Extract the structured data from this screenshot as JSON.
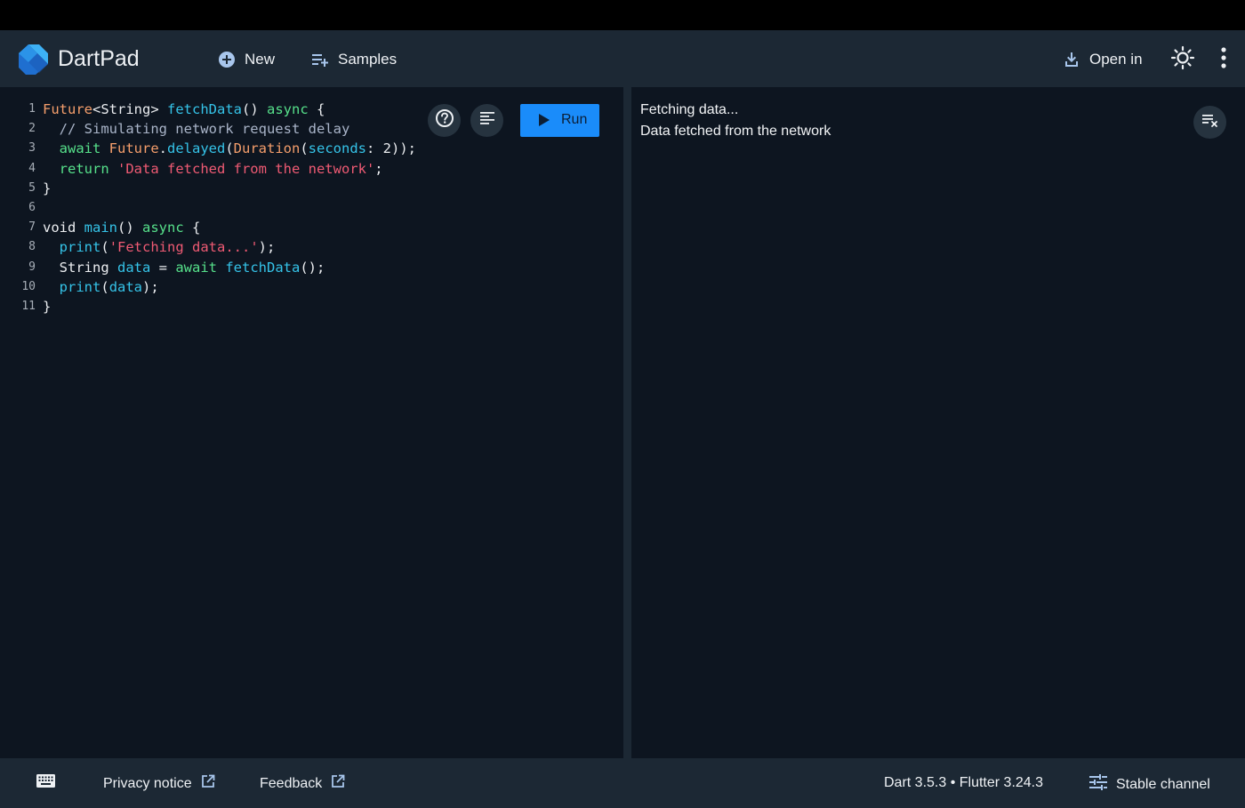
{
  "app": {
    "title": "DartPad"
  },
  "header": {
    "new_label": "New",
    "samples_label": "Samples",
    "open_in_label": "Open in"
  },
  "editor": {
    "run_label": "Run",
    "line_numbers": [
      "1",
      "2",
      "3",
      "4",
      "5",
      "6",
      "7",
      "8",
      "9",
      "10",
      "11"
    ],
    "code_lines": [
      [
        [
          "Future",
          "type"
        ],
        [
          "<String> ",
          "plain"
        ],
        [
          "fetchData",
          "func"
        ],
        [
          "() ",
          "plain"
        ],
        [
          "async",
          "kw"
        ],
        [
          " {",
          "plain"
        ]
      ],
      [
        [
          "  // Simulating network request delay",
          "cmt"
        ]
      ],
      [
        [
          "  await ",
          "kw"
        ],
        [
          "Future",
          "type"
        ],
        [
          ".",
          "plain"
        ],
        [
          "delayed",
          "func"
        ],
        [
          "(",
          "plain"
        ],
        [
          "Duration",
          "type"
        ],
        [
          "(",
          "plain"
        ],
        [
          "seconds",
          "func"
        ],
        [
          ": 2));",
          "plain"
        ]
      ],
      [
        [
          "  return ",
          "kw"
        ],
        [
          "'Data fetched from the network'",
          "str"
        ],
        [
          ";",
          "plain"
        ]
      ],
      [
        [
          "}",
          "plain"
        ]
      ],
      [
        [
          "",
          "plain"
        ]
      ],
      [
        [
          "void ",
          "plain"
        ],
        [
          "main",
          "func"
        ],
        [
          "() ",
          "plain"
        ],
        [
          "async",
          "kw"
        ],
        [
          " {",
          "plain"
        ]
      ],
      [
        [
          "  ",
          "plain"
        ],
        [
          "print",
          "func"
        ],
        [
          "(",
          "plain"
        ],
        [
          "'Fetching data...'",
          "str"
        ],
        [
          ");",
          "plain"
        ]
      ],
      [
        [
          "  String ",
          "plain"
        ],
        [
          "data",
          "func"
        ],
        [
          " = ",
          "plain"
        ],
        [
          "await ",
          "kw"
        ],
        [
          "fetchData",
          "func"
        ],
        [
          "();",
          "plain"
        ]
      ],
      [
        [
          "  ",
          "plain"
        ],
        [
          "print",
          "func"
        ],
        [
          "(",
          "plain"
        ],
        [
          "data",
          "func"
        ],
        [
          ");",
          "plain"
        ]
      ],
      [
        [
          "}",
          "plain"
        ]
      ]
    ]
  },
  "console": {
    "lines": [
      "Fetching data...",
      "Data fetched from the network"
    ]
  },
  "footer": {
    "privacy_label": "Privacy notice",
    "feedback_label": "Feedback",
    "version": "Dart 3.5.3 • Flutter 3.24.3",
    "channel_label": "Stable channel"
  },
  "icons": {
    "logo": "dart-logo-icon",
    "new": "add-circle-icon",
    "samples": "playlist-add-icon",
    "open_in": "download-icon",
    "theme": "brightness-icon",
    "more": "more-vert-icon",
    "help": "help-icon",
    "format": "format-align-icon",
    "run": "play-icon",
    "clear": "clear-console-icon",
    "keyboard": "keyboard-icon",
    "external": "open-in-new-icon",
    "channel": "tune-icon"
  },
  "colors": {
    "accent": "#1a8cfa",
    "background": "#0d1520",
    "bar": "#1c2834",
    "type": "#f59e6b",
    "function": "#35c3e8",
    "keyword": "#56e08a",
    "string": "#ef5a73",
    "comment": "#a9b4c8"
  }
}
